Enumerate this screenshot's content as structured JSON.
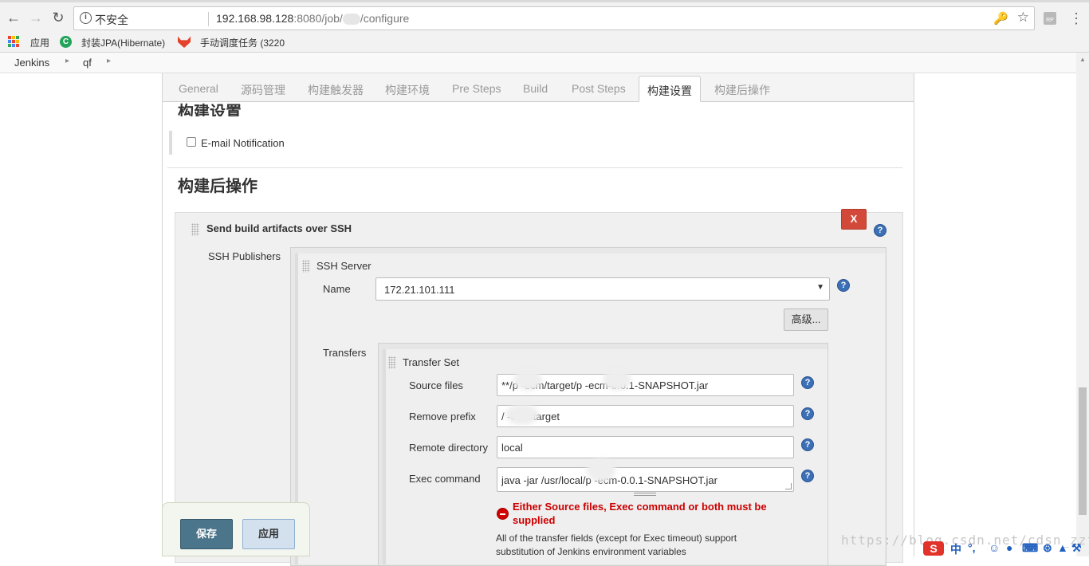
{
  "browser": {
    "insecure_label": "不安全",
    "url_host": "192.168.98.128",
    "url_port_path": ":8080/job/",
    "url_tail": "/configure"
  },
  "bookmarks": [
    {
      "label": "应用"
    },
    {
      "label": "封装JPA(Hibernate)"
    },
    {
      "label": "手动调度任务 (3220"
    }
  ],
  "breadcrumb": [
    "Jenkins",
    "qf"
  ],
  "tabs": [
    "General",
    "源码管理",
    "构建触发器",
    "构建环境",
    "Pre Steps",
    "Build",
    "Post Steps",
    "构建设置",
    "构建后操作"
  ],
  "active_tab": "构建设置",
  "build_settings": {
    "title": "构建设置",
    "email_label": "E-mail Notification"
  },
  "post_build": {
    "title": "构建后操作",
    "step_title": "Send build artifacts over SSH",
    "delete_label": "X",
    "publishers_label": "SSH Publishers",
    "ssh_server": {
      "title": "SSH Server",
      "name_label": "Name",
      "name_value": "172.21.101.111",
      "advanced_label": "高级..."
    },
    "transfers_label": "Transfers",
    "transfer_set": {
      "title": "Transfer Set",
      "source_files_label": "Source files",
      "source_files_value": "**/p        -ecm/target/p        -ecm-0.0.1-SNAPSHOT.jar",
      "remove_prefix_label": "Remove prefix",
      "remove_prefix_value": "/             -ecm/target",
      "remote_dir_label": "Remote directory",
      "remote_dir_value": "local",
      "exec_command_label": "Exec command",
      "exec_command_value": "java -jar /usr/local/p        -ecm-0.0.1-SNAPSHOT.jar",
      "error": "Either Source files, Exec command or both must be supplied",
      "hint": "All of the transfer fields (except for Exec timeout) support substitution of Jenkins environment variables"
    }
  },
  "footer": {
    "save_label": "保存",
    "apply_label": "应用"
  },
  "watermark": "https://blog.csdn.net/cdsn_zzf",
  "ime": {
    "logo": "S",
    "mode": "中"
  },
  "colors": {
    "save_bg": "#4b758b",
    "apply_bg": "#d3e1ef",
    "delete_bg": "#d24939",
    "help_bg": "#3b6fb6",
    "error": "#cc0000"
  }
}
